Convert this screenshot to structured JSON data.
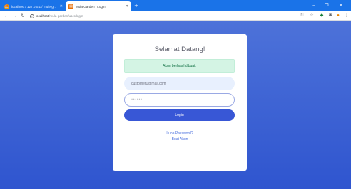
{
  "browser": {
    "tabs": [
      {
        "title": "localhost / 127.0.0.1 / mule-gard",
        "active": false
      },
      {
        "title": "Mula Garden | Login",
        "active": true
      }
    ],
    "new_tab_glyph": "+",
    "window_controls": {
      "minimize": "–",
      "maximize": "❐",
      "close": "✕"
    },
    "url": {
      "host": "localhost",
      "path": "/mula-garden/user/login"
    },
    "tab_bar_color": "#1a73e8"
  },
  "page": {
    "background_colors": [
      "#4d72d9",
      "#2f55cf"
    ],
    "card": {
      "title": "Selamat Datang!",
      "alert": "Akun berhasil dibuat.",
      "email_value": "customer1@mail.com",
      "password_value": "••••••",
      "login_label": "Login",
      "forgot_link": "Lupa Password?",
      "register_link": "Buat Akun"
    },
    "accent_color": "#3857d6",
    "alert_color": "#d4f4e4"
  },
  "icons": [
    "back-icon",
    "forward-icon",
    "reload-icon",
    "info-icon",
    "key-icon",
    "star-icon",
    "extension-icon",
    "puzzle-icon",
    "profile-icon",
    "menu-icon"
  ]
}
